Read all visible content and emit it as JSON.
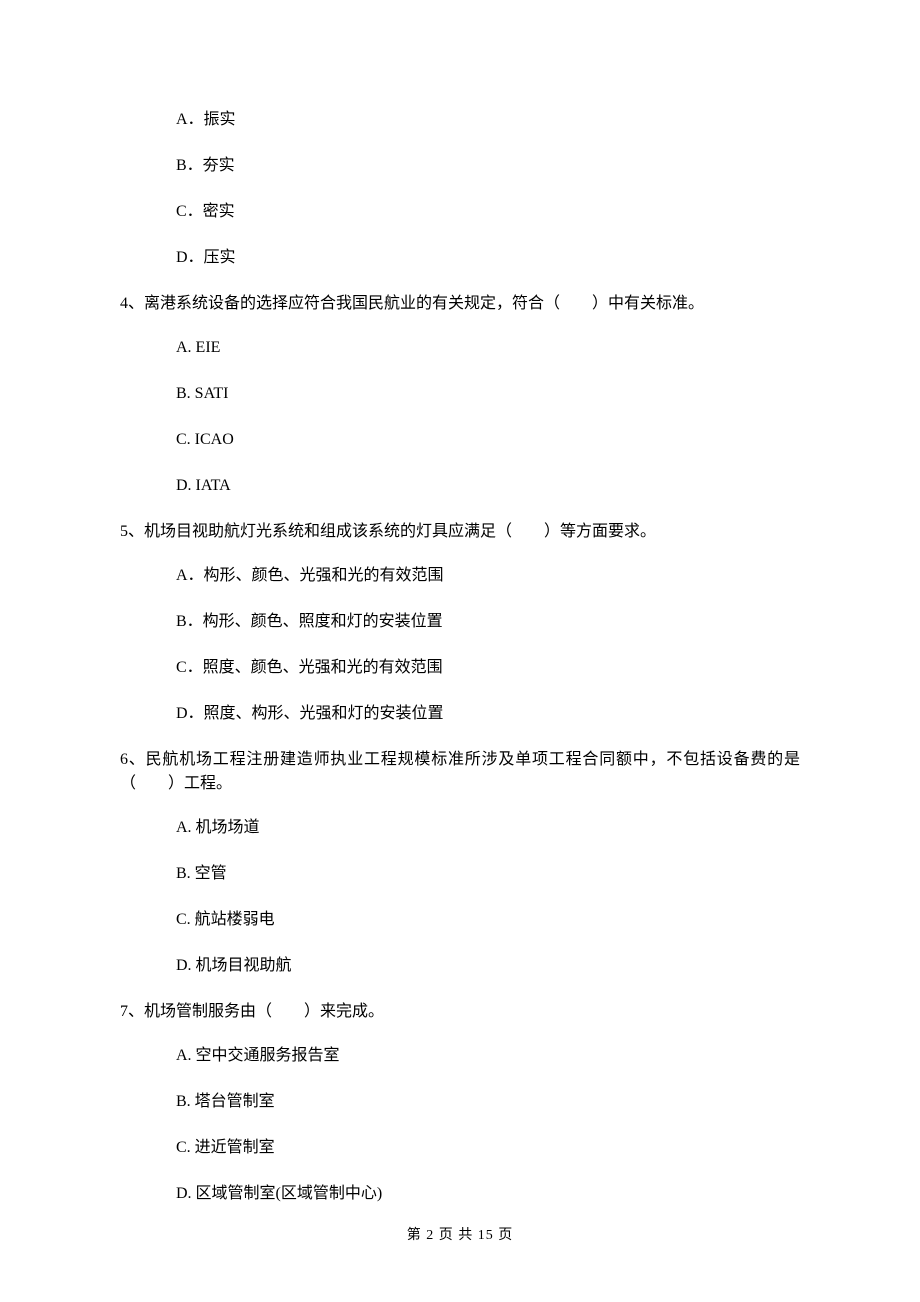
{
  "questions": [
    {
      "stem": null,
      "options": [
        "A．振实",
        "B．夯实",
        "C．密实",
        "D．压实"
      ]
    },
    {
      "stem": "4、离港系统设备的选择应符合我国民航业的有关规定，符合（　　）中有关标准。",
      "options": [
        "A.  EIE",
        "B.  SATI",
        "C.  ICAO",
        "D.  IATA"
      ]
    },
    {
      "stem": "5、机场目视助航灯光系统和组成该系统的灯具应满足（　　）等方面要求。",
      "options": [
        "A．构形、颜色、光强和光的有效范围",
        "B．构形、颜色、照度和灯的安装位置",
        "C．照度、颜色、光强和光的有效范围",
        "D．照度、构形、光强和灯的安装位置"
      ]
    },
    {
      "stem": "6、民航机场工程注册建造师执业工程规模标准所涉及单项工程合同额中，不包括设备费的是（　　）工程。",
      "options": [
        "A.  机场场道",
        "B.  空管",
        "C.  航站楼弱电",
        "D.  机场目视助航"
      ]
    },
    {
      "stem": "7、机场管制服务由（　　）来完成。",
      "options": [
        "A.  空中交通服务报告室",
        "B.  塔台管制室",
        "C.  进近管制室",
        "D.  区域管制室(区域管制中心)"
      ]
    }
  ],
  "footer": "第 2 页 共 15 页"
}
